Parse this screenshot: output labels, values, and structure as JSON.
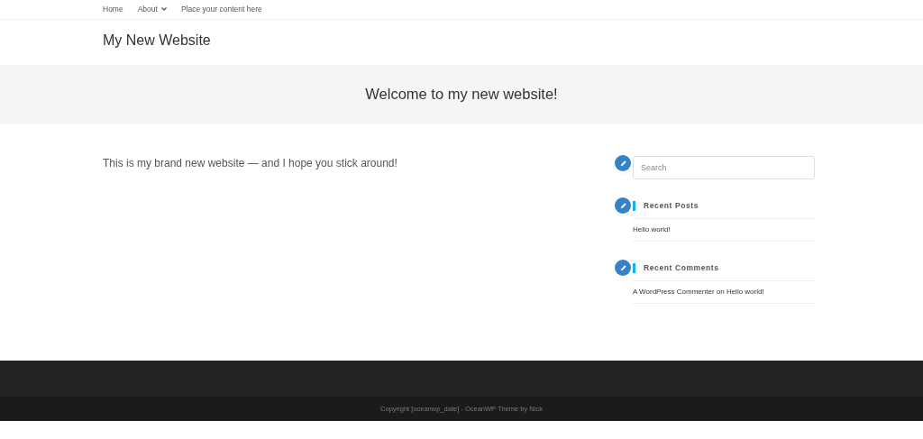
{
  "nav": [
    {
      "label": "Home",
      "has_dropdown": false
    },
    {
      "label": "About",
      "has_dropdown": true
    },
    {
      "label": "Place your content here",
      "has_dropdown": false
    }
  ],
  "site_title": "My New Website",
  "page_title": "Welcome to my new website!",
  "content": "This is my brand new website — and I hope you stick around!",
  "sidebar": {
    "search": {
      "placeholder": "Search"
    },
    "widgets": [
      {
        "kind": "posts",
        "title": "Recent Posts",
        "items": [
          {
            "post": "Hello world!"
          }
        ]
      },
      {
        "kind": "comments",
        "title": "Recent Comments",
        "items": [
          {
            "author": "A WordPress Commenter",
            "connector": "on",
            "post": "Hello world!"
          }
        ]
      }
    ]
  },
  "footer": {
    "copyright": "Copyright [oceanwp_date] - OceanWP Theme by Nick"
  }
}
